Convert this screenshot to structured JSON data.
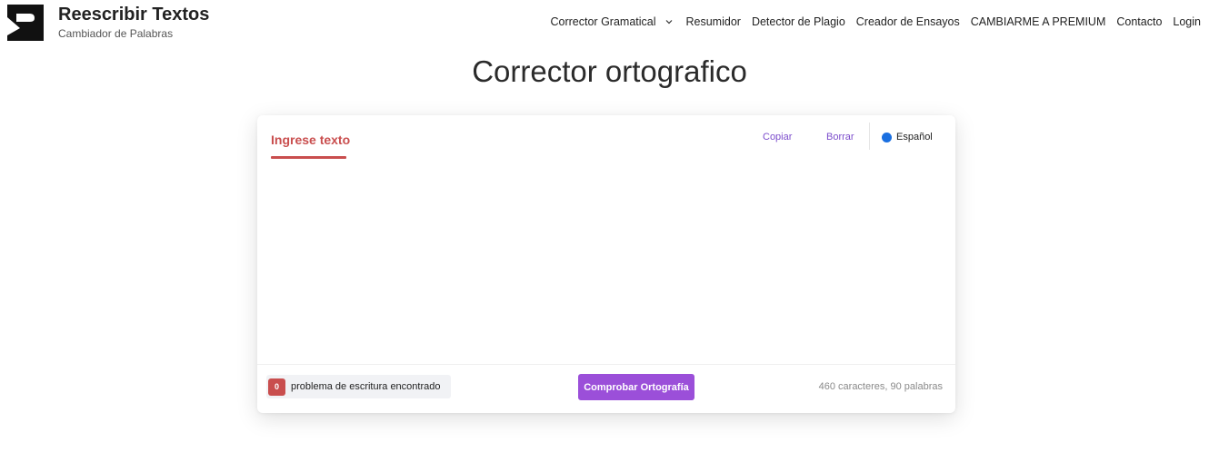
{
  "brand": {
    "title": "Reescribir Textos",
    "subtitle": "Cambiador de Palabras",
    "logo_icon": "reescribir-logo-icon"
  },
  "nav": {
    "items": [
      {
        "label": "Corrector Gramatical",
        "has_dropdown": true
      },
      {
        "label": "Resumidor"
      },
      {
        "label": "Detector de Plagio"
      },
      {
        "label": "Creador de Ensayos"
      },
      {
        "label": "CAMBIARME A PREMIUM"
      },
      {
        "label": "Contacto"
      },
      {
        "label": "Login"
      }
    ]
  },
  "page": {
    "title": "Corrector ortografico"
  },
  "editor": {
    "tab_label": "Ingrese texto",
    "copy_label": "Copiar",
    "clear_label": "Borrar",
    "language_label": "Español",
    "text_value": "",
    "issues_count": "0",
    "issues_label": "problema de escritura encontrado",
    "check_button_label": "Comprobar Ortografía",
    "counts_label": "460 caracteres, 90 palabras"
  },
  "colors": {
    "accent_red": "#c94e4e",
    "accent_purple": "#9b4fd9",
    "link_purple": "#7c4dcc",
    "language_dot": "#1a6fe0"
  }
}
